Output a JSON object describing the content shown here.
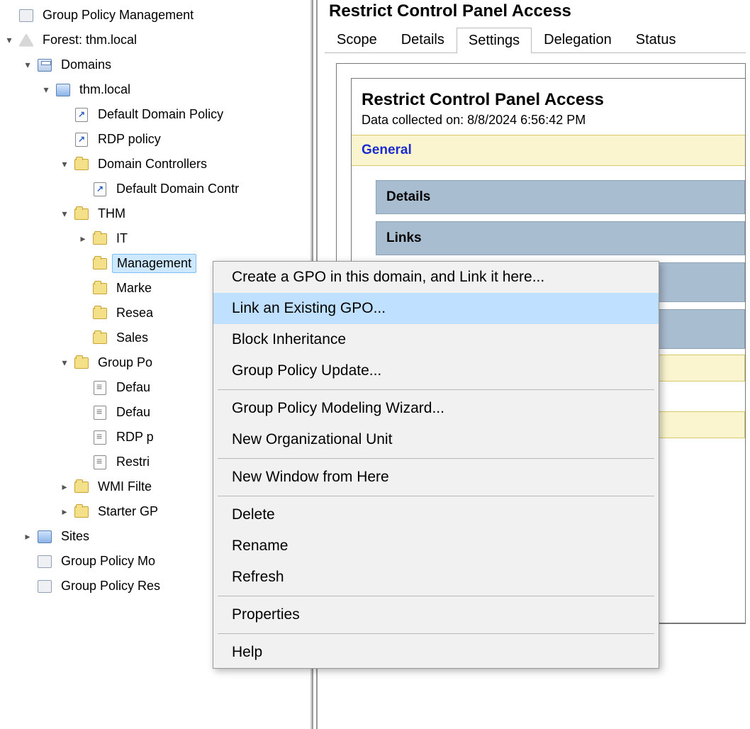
{
  "tree": {
    "root": "Group Policy Management",
    "forest": "Forest: thm.local",
    "domains": "Domains",
    "domain": "thm.local",
    "default_domain_policy": "Default Domain Policy",
    "rdp_policy": "RDP policy",
    "domain_controllers": "Domain Controllers",
    "default_domain_contr": "Default Domain Contr",
    "thm": "THM",
    "it": "IT",
    "management": "Management",
    "marketing": "Marke",
    "research": "Resea",
    "sales": "Sales",
    "gpo": "Group Po",
    "gpo_default1": "Defau",
    "gpo_default2": "Defau",
    "gpo_rdp": "RDP p",
    "gpo_restrict": "Restri",
    "wmi": "WMI Filte",
    "starter": "Starter GP",
    "sites": "Sites",
    "gpmodeling": "Group Policy Mo",
    "gpresults": "Group Policy Res"
  },
  "main": {
    "title": "Restrict Control Panel Access",
    "tabs": [
      "Scope",
      "Details",
      "Settings",
      "Delegation",
      "Status"
    ],
    "active_tab": "Settings",
    "report_title": "Restrict Control Panel Access",
    "report_sub": "Data collected on: 8/8/2024 6:56:42 PM",
    "general": "General",
    "details": "Details",
    "links": "Links"
  },
  "contextmenu": {
    "items": [
      "Create a GPO in this domain, and Link it here...",
      "Link an Existing GPO...",
      "Block Inheritance",
      "Group Policy Update...",
      "-",
      "Group Policy Modeling Wizard...",
      "New Organizational Unit",
      "-",
      "New Window from Here",
      "-",
      "Delete",
      "Rename",
      "Refresh",
      "-",
      "Properties",
      "-",
      "Help"
    ],
    "hover_index": 1
  }
}
